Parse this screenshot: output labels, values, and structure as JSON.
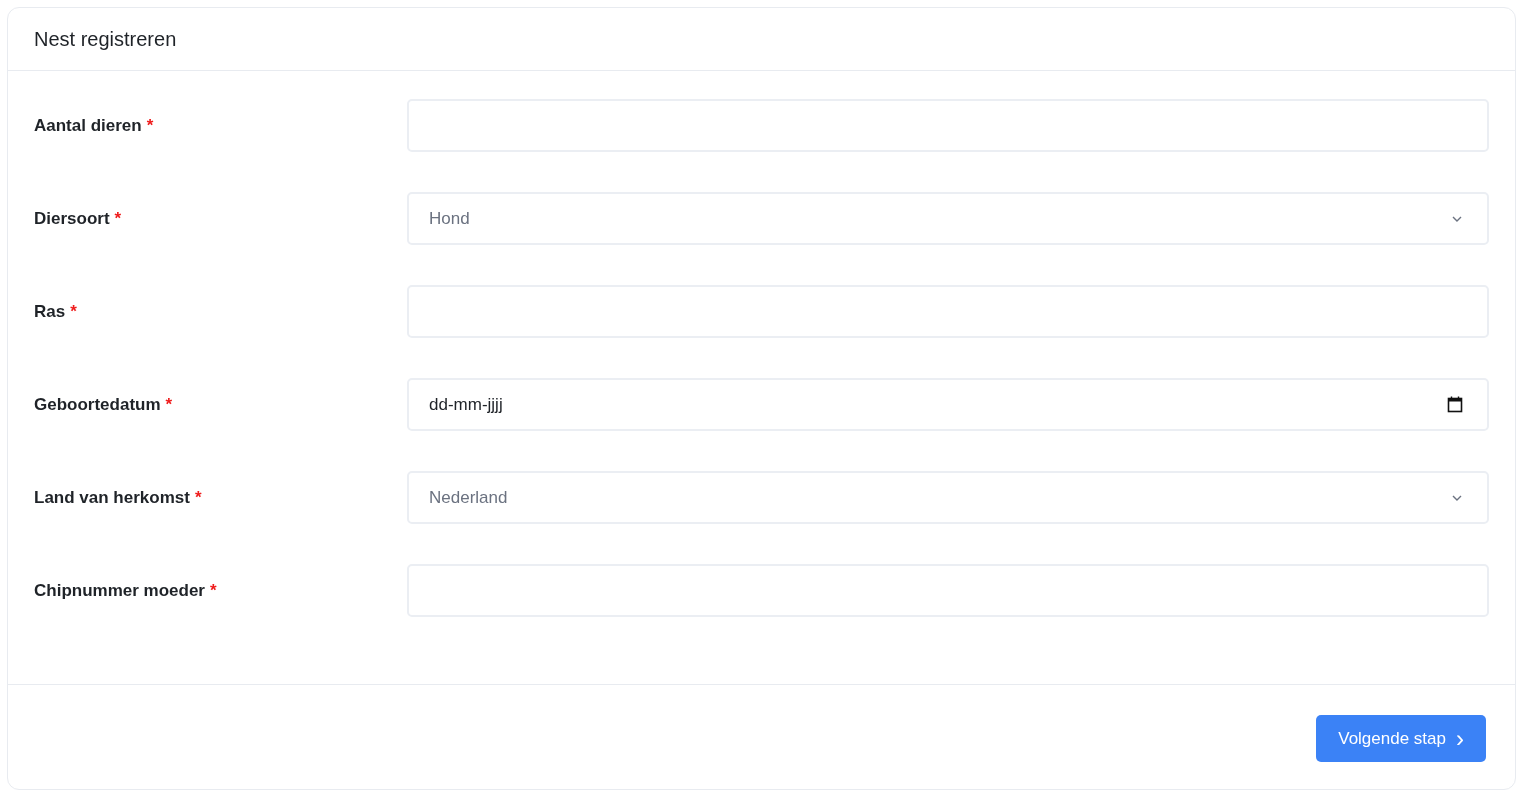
{
  "card": {
    "title": "Nest registreren"
  },
  "fields": [
    {
      "kind": "text",
      "label": "Aantal dieren",
      "required_mark": "*"
    },
    {
      "kind": "select",
      "label": "Diersoort",
      "required_mark": "*",
      "value": "Hond"
    },
    {
      "kind": "text",
      "label": "Ras",
      "required_mark": "*"
    },
    {
      "kind": "date",
      "label": "Geboortedatum",
      "required_mark": "*",
      "value": "dd-mm-jjjj"
    },
    {
      "kind": "select",
      "label": "Land van herkomst",
      "required_mark": "*",
      "value": "Nederland"
    },
    {
      "kind": "text",
      "label": "Chipnummer moeder",
      "required_mark": "*"
    }
  ],
  "footer": {
    "next_button": {
      "label": "Volgende stap",
      "icon": "›"
    }
  }
}
